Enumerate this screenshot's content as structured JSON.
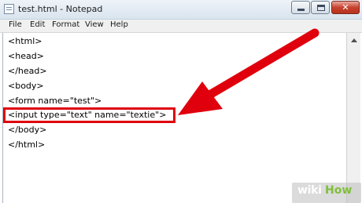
{
  "window": {
    "title": "test.html - Notepad",
    "controls": {
      "minimize": "minimize-icon",
      "maximize": "maximize-icon",
      "close_glyph": "✕"
    }
  },
  "menu": [
    "File",
    "Edit",
    "Format",
    "View",
    "Help"
  ],
  "editor": {
    "lines": [
      "<html>",
      "<head>",
      "</head>",
      "<body>",
      "<form name=\"test\">",
      "<input type=\"text\" name=\"textie\">",
      "</body>",
      "</html>"
    ],
    "highlighted_line_index": 5
  },
  "annotation": {
    "arrow_color": "#e0000d",
    "box_color": "#e0000d"
  },
  "watermark": {
    "wiki": "wiki",
    "how": "How"
  }
}
